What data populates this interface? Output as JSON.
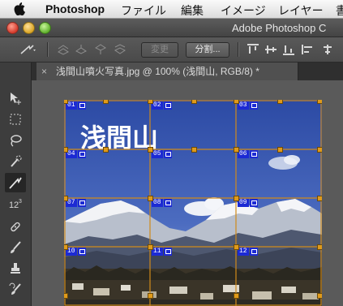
{
  "menubar": {
    "app_name": "Photoshop",
    "items": [
      "ファイル",
      "編集",
      "イメージ",
      "レイヤー",
      "書"
    ]
  },
  "window": {
    "title": "Adobe Photoshop C"
  },
  "options": {
    "divide_label": "変更",
    "split_label": "分割..."
  },
  "document_tab": {
    "close_glyph": "×",
    "title": "浅間山噴火写真.jpg @ 100% (浅間山, RGB/8) *"
  },
  "tools_icons": [
    "slice-select-icon",
    "marquee-icon",
    "lasso-icon",
    "quick-select-icon",
    "slice-icon",
    "count-tool-icon",
    "healing-brush-icon",
    "brush-icon",
    "clone-stamp-icon",
    "history-brush-icon"
  ],
  "canvas": {
    "overlay_text": "浅間山",
    "slices": [
      {
        "num": "01"
      },
      {
        "num": "02"
      },
      {
        "num": "03"
      },
      {
        "num": "04"
      },
      {
        "num": "05"
      },
      {
        "num": "06"
      },
      {
        "num": "07"
      },
      {
        "num": "08"
      },
      {
        "num": "09"
      },
      {
        "num": "10"
      },
      {
        "num": "11"
      },
      {
        "num": "12"
      }
    ]
  },
  "colors": {
    "slice_line": "#d08a1a",
    "slice_badge": "#1c2ad4",
    "sky_top": "#2f4fa8",
    "sky_bottom": "#7b95d4"
  }
}
